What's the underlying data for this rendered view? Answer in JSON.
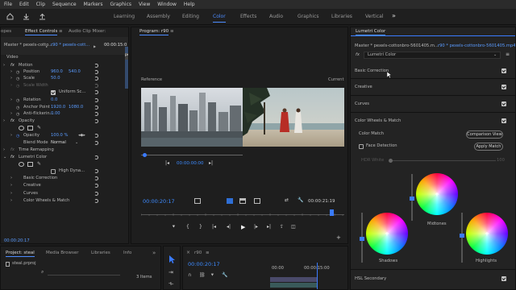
{
  "menu": [
    "File",
    "Edit",
    "Clip",
    "Sequence",
    "Markers",
    "Graphics",
    "View",
    "Window",
    "Help"
  ],
  "workspaces": {
    "items": [
      "Learning",
      "Assembly",
      "Editing",
      "Color",
      "Effects",
      "Audio",
      "Graphics",
      "Libraries",
      "Vertical"
    ],
    "active": "Color",
    "more": "»"
  },
  "effect_controls": {
    "tabs": [
      "opes",
      "Effect Controls",
      "Audio Clip Mixer: SplitScree"
    ],
    "tab_menu": "≡",
    "master": "Master * pexels-cotto...",
    "clip": "r90 * pexels-cott...",
    "timecode": "00:00:15:0",
    "clip_block": "pexels-cotton",
    "section": "Video",
    "motion": "Motion",
    "position_label": "Position",
    "position_x": "960.0",
    "position_y": "540.0",
    "scale_label": "Scale",
    "scale_value": "50.0",
    "scale_width_label": "Scale Width",
    "uniform_scale": "Uniform Sc...",
    "rotation_label": "Rotation",
    "rotation_value": "0.0",
    "anchor_label": "Anchor Point",
    "anchor_x": "1920.0",
    "anchor_y": "1080.0",
    "antiflicker_label": "Anti-flickerin...",
    "antiflicker_value": "0.00",
    "opacity": "Opacity",
    "opacity_label": "Opacity",
    "opacity_value": "100.0 %",
    "blend_label": "Blend Mode",
    "blend_value": "Normal",
    "time_remap": "Time Remapping",
    "lumetri": "Lumetri Color",
    "high_dynamic": "High Dyna...",
    "basic_correction": "Basic Correction",
    "creative": "Creative",
    "curves": "Curves",
    "color_wheels": "Color Wheels & Match",
    "bottom_timecode": "00:00:20:17"
  },
  "program": {
    "title": "Program: r90",
    "menu": "≡",
    "reference_label": "Reference",
    "current_label": "Current",
    "ref_timecode": "00:00:00:00",
    "current_timecode": "00:00:20:17",
    "duration": "00:00:21:19"
  },
  "lumetri": {
    "tab": "Lumetri Color",
    "master": "Master * pexels-cottonbro-5601405.m...",
    "clip": "r90 * pexels-cottonbro-5601405.mp4",
    "fx_label": "fx",
    "effect": "Lumetri Color",
    "sections": [
      "Basic Correction",
      "Creative",
      "Curves",
      "Color Wheels & Match"
    ],
    "color_match": "Color Match",
    "comparison_view": "Comparison View",
    "face_detection": "Face Detection",
    "apply_match": "Apply Match",
    "hdr_white": "HDR White",
    "hdr_value": "100",
    "midtones": "Midtones",
    "shadows": "Shadows",
    "highlights": "Highlights",
    "hsl": "HSL Secondary"
  },
  "project": {
    "tabs": [
      "Project: steal",
      "Media Browser",
      "Libraries",
      "Info"
    ],
    "file": "steal.prproj",
    "items": "3 Items",
    "more": "»"
  },
  "timeline": {
    "menu": "≡",
    "timecode": "00:00:20:17",
    "ticks": [
      "00:00",
      "00:00:15:00"
    ]
  },
  "colors": {
    "accent": "#4d8cff",
    "timecode": "#3d8bff",
    "panel_bg": "#232323"
  }
}
